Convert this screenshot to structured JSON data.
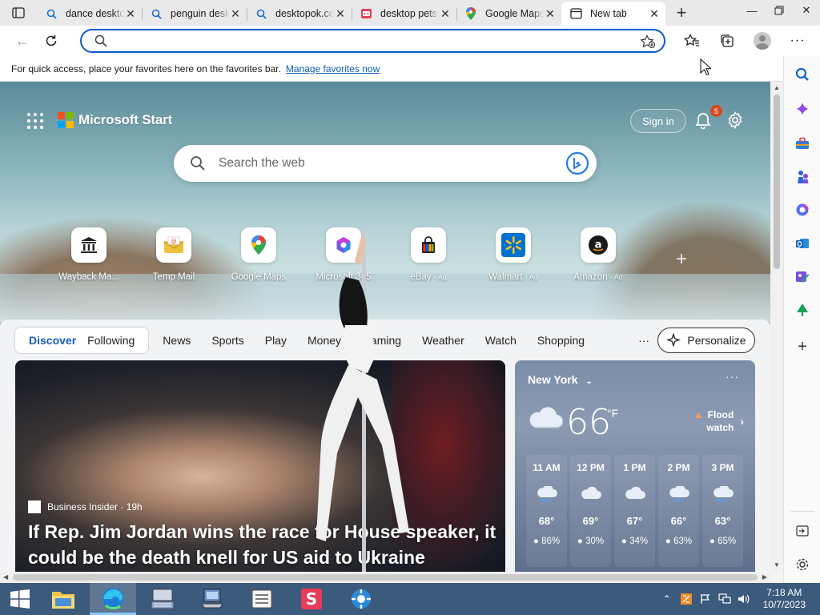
{
  "browser": {
    "tabs": [
      {
        "title": "dance desktop",
        "favicon": "search-icon",
        "active": false
      },
      {
        "title": "penguin desktop",
        "favicon": "search-icon",
        "active": false
      },
      {
        "title": "desktopok.com",
        "favicon": "search-icon",
        "active": false
      },
      {
        "title": "desktop pets",
        "favicon": "pets-app-icon",
        "active": false
      },
      {
        "title": "Google Maps",
        "favicon": "google-maps-icon",
        "active": false
      },
      {
        "title": "New tab",
        "favicon": "newtab-icon",
        "active": true
      }
    ],
    "address": {
      "value": "",
      "placeholder": ""
    },
    "favorites_bar": {
      "message": "For quick access, place your favorites here on the favorites bar.",
      "link": "Manage favorites now"
    }
  },
  "newtab": {
    "brand": "Microsoft Start",
    "sign_in": "Sign in",
    "notification_count": "5",
    "search_placeholder": "Search the web",
    "quick_links": [
      {
        "label": "Wayback Ma...",
        "ad": "",
        "icon": "archive-icon"
      },
      {
        "label": "Temp Mail",
        "ad": "",
        "icon": "mail-icon"
      },
      {
        "label": "Google Maps",
        "ad": "",
        "icon": "google-maps-icon"
      },
      {
        "label": "Microsoft 365",
        "ad": "",
        "icon": "m365-icon"
      },
      {
        "label": "eBay",
        "ad": "· Ad",
        "icon": "ebay-icon"
      },
      {
        "label": "Walmart",
        "ad": "· Ad",
        "icon": "walmart-icon"
      },
      {
        "label": "Amazon",
        "ad": "· Ad",
        "icon": "amazon-icon"
      }
    ],
    "pivots_group": [
      "Discover",
      "Following"
    ],
    "pivots": [
      "News",
      "Sports",
      "Play",
      "Money",
      "Gaming",
      "Weather",
      "Watch",
      "Shopping"
    ],
    "more": "···",
    "personalize": "Personalize",
    "hero": {
      "source": "Business Insider · 19h",
      "headline": "If Rep. Jim Jordan wins the race for House speaker, it could be the death knell for US aid to Ukraine"
    },
    "weather": {
      "city": "New York",
      "temp": "66",
      "unit": "°F",
      "alert_line1": "Flood",
      "alert_line2": "watch",
      "hours": [
        {
          "time": "11 AM",
          "temp": "68°",
          "precip": "86%",
          "icon": "rain-cloud-icon"
        },
        {
          "time": "12 PM",
          "temp": "69°",
          "precip": "30%",
          "icon": "cloud-icon"
        },
        {
          "time": "1 PM",
          "temp": "67°",
          "precip": "34%",
          "icon": "cloud-icon"
        },
        {
          "time": "2 PM",
          "temp": "66°",
          "precip": "63%",
          "icon": "rain-cloud-icon"
        },
        {
          "time": "3 PM",
          "temp": "63°",
          "precip": "65%",
          "icon": "rain-cloud-icon"
        }
      ]
    }
  },
  "taskbar": {
    "apps": [
      "file-explorer-icon",
      "edge-icon",
      "keyboard-app-icon",
      "computer-app-icon",
      "list-app-icon",
      "s-app-icon",
      "settings-app-icon"
    ],
    "time": "7:18 AM",
    "date": "10/7/2023"
  },
  "colors": {
    "accent": "#0a5ac8",
    "link": "#0f5fb8",
    "taskbar": "#3b5a7c",
    "badge": "#d34a24"
  }
}
